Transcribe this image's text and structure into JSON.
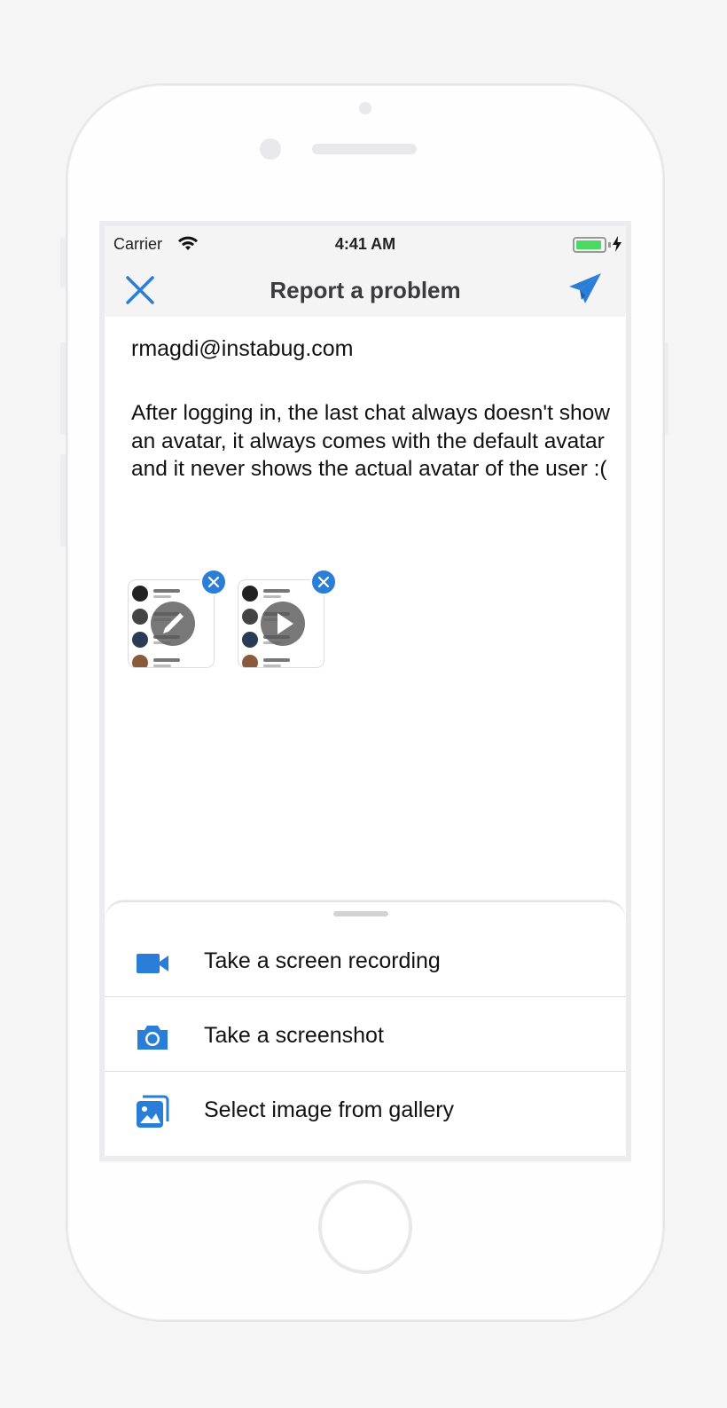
{
  "status_bar": {
    "carrier": "Carrier",
    "time": "4:41 AM"
  },
  "nav": {
    "title": "Report a problem"
  },
  "form": {
    "email": "rmagdi@instabug.com",
    "description": "After logging in, the last chat always doesn't show an avatar, it always comes with the default avatar and it never shows the actual avatar of the user :("
  },
  "attachments": [
    {
      "type": "screenshot",
      "action": "edit"
    },
    {
      "type": "video",
      "action": "play"
    }
  ],
  "sheet": {
    "items": [
      {
        "label": "Take a screen recording",
        "icon": "video-camera-icon"
      },
      {
        "label": "Take a screenshot",
        "icon": "camera-icon"
      },
      {
        "label": "Select image from gallery",
        "icon": "gallery-icon"
      }
    ]
  },
  "colors": {
    "accent": "#2a7ed8",
    "battery": "#4cd964"
  }
}
